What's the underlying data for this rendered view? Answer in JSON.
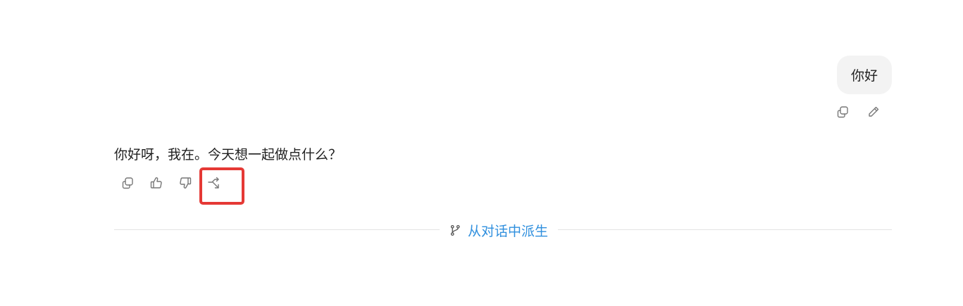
{
  "user_message": {
    "text": "你好",
    "actions": [
      {
        "icon": "copy-icon"
      },
      {
        "icon": "edit-icon"
      }
    ]
  },
  "assistant_message": {
    "text": "你好呀，我在。今天想一起做点什么？",
    "actions": [
      {
        "icon": "copy-icon"
      },
      {
        "icon": "thumbs-up-icon"
      },
      {
        "icon": "thumbs-down-icon"
      },
      {
        "icon": "branch-out-icon",
        "highlighted": true
      }
    ]
  },
  "fork_divider": {
    "label": "从对话中派生",
    "icon": "git-branch-icon",
    "color": "#2f8fde"
  },
  "colors": {
    "highlight": "#e53935",
    "bubble": "#f3f3f3",
    "icon": "#777777"
  }
}
